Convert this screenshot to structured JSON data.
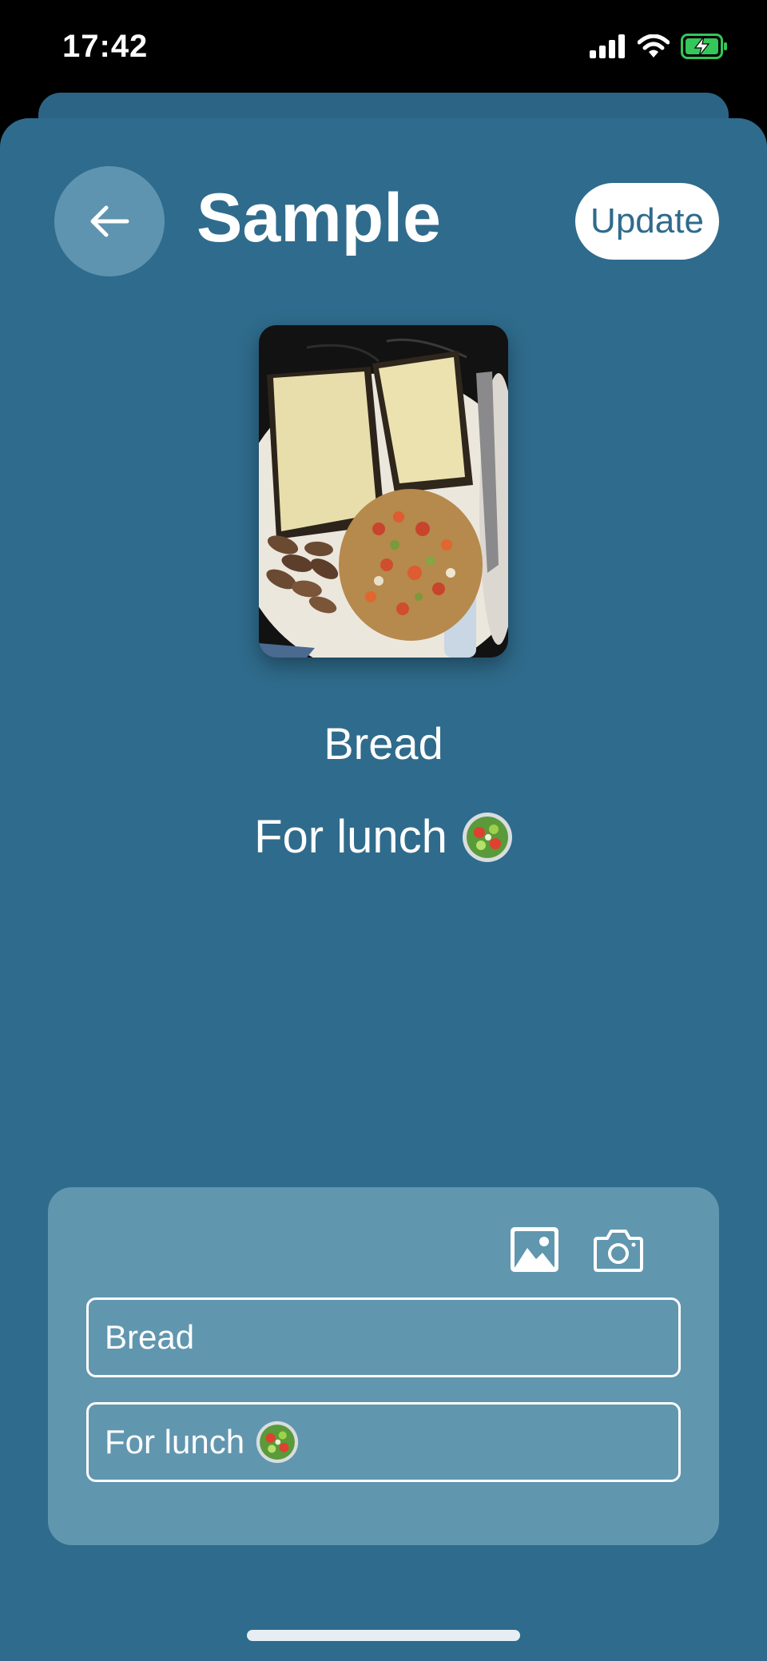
{
  "status_bar": {
    "time": "17:42"
  },
  "header": {
    "title": "Sample",
    "update_label": "Update"
  },
  "item": {
    "name": "Bread",
    "description": "For lunch"
  },
  "form": {
    "name_value": "Bread",
    "description_value": "For lunch"
  },
  "icons": {
    "back": "arrow-left-icon",
    "gallery": "image-icon",
    "camera": "camera-icon",
    "salad": "salad-bowl-emoji"
  },
  "colors": {
    "background": "#2f6b8c",
    "card": "#6196af",
    "accent": "#ffffff",
    "battery": "#34c759"
  }
}
